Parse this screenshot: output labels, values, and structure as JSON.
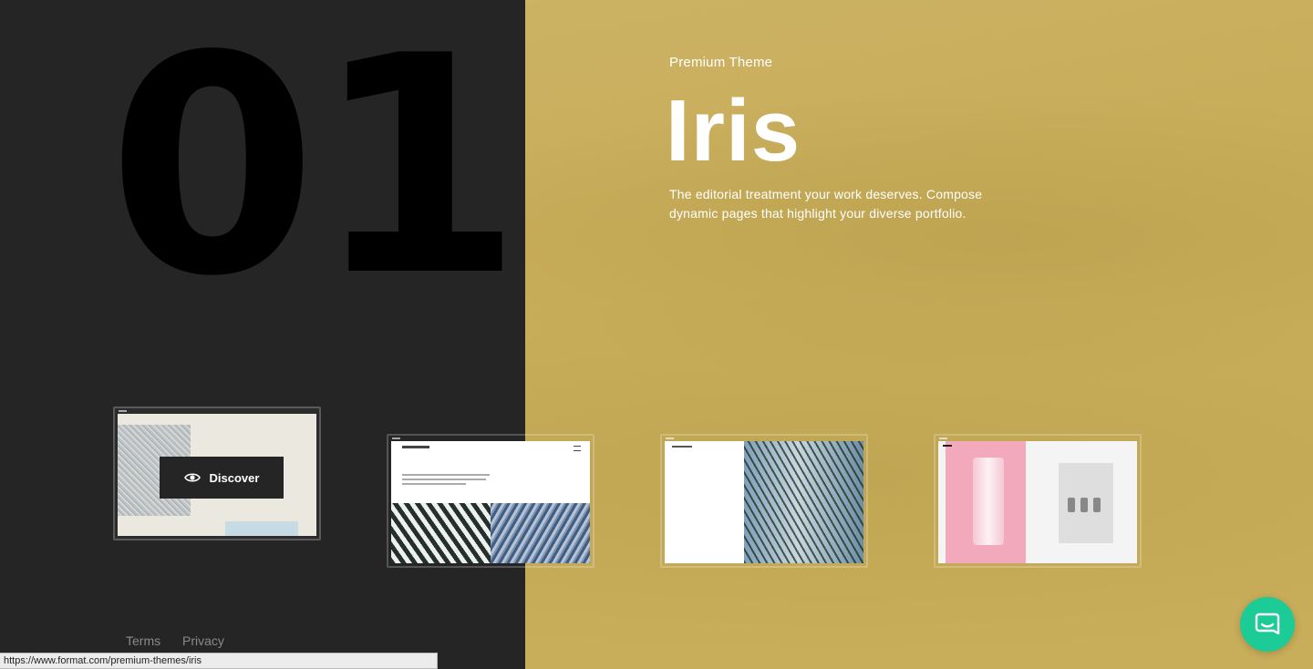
{
  "hero": {
    "index_number": "01",
    "kicker": "Premium Theme",
    "title": "Iris",
    "description": "The editorial treatment your work deserves. Compose dynamic pages that highlight your diverse portfolio."
  },
  "thumbnails": {
    "discover_label": "Discover",
    "icons": [
      "eye-icon"
    ]
  },
  "footer": {
    "terms": "Terms",
    "privacy": "Privacy"
  },
  "status_bar": {
    "url": "https://www.format.com/premium-themes/iris"
  },
  "chat": {
    "icon": "chat-icon"
  },
  "colors": {
    "left_bg": "#252525",
    "right_bg": "#c8ad5a",
    "chat_accent": "#1dcb97"
  }
}
